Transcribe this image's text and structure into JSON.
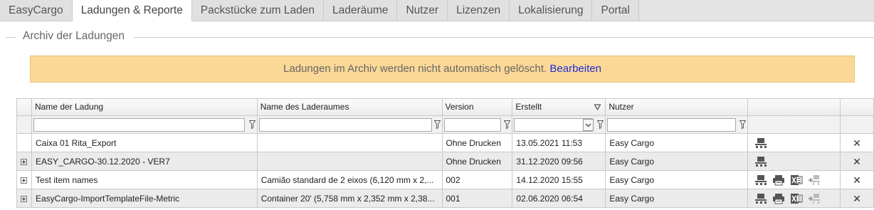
{
  "tabs": [
    {
      "label": "EasyCargo",
      "active": false
    },
    {
      "label": "Ladungen & Reporte",
      "active": true
    },
    {
      "label": "Packstücke zum Laden",
      "active": false
    },
    {
      "label": "Laderäume",
      "active": false
    },
    {
      "label": "Nutzer",
      "active": false
    },
    {
      "label": "Lizenzen",
      "active": false
    },
    {
      "label": "Lokalisierung",
      "active": false
    },
    {
      "label": "Portal",
      "active": false
    }
  ],
  "section": {
    "title": "Archiv der Ladungen"
  },
  "banner": {
    "text": "Ladungen im Archiv werden nicht automatisch gelöscht.",
    "link": "Bearbeiten"
  },
  "grid": {
    "columns": [
      "Name der Ladung",
      "Name des Laderaumes",
      "Version",
      "Erstellt",
      "Nutzer"
    ],
    "sorted_column": "Erstellt",
    "sort_direction": "descending",
    "rows": [
      {
        "expandable": false,
        "name": "Caixa 01 Rita_Export",
        "space": "",
        "version": "Ohne Drucken",
        "created": "13.05.2021 11:53",
        "user": "Easy Cargo",
        "actions": [
          "pallet-icon"
        ]
      },
      {
        "expandable": true,
        "name": "EASY_CARGO-30.12.2020 - VER7",
        "space": "",
        "version": "Ohne Drucken",
        "created": "31.12.2020 09:56",
        "user": "Easy Cargo",
        "actions": [
          "pallet-icon"
        ]
      },
      {
        "expandable": true,
        "name": "Test item names",
        "space": "Camião standard de 2 eixos (6,120 mm x 2,...",
        "version": "002",
        "created": "14.12.2020 15:55",
        "user": "Easy Cargo",
        "actions": [
          "pallet-icon",
          "printer-icon",
          "excel-icon",
          "add-pallet-icon"
        ]
      },
      {
        "expandable": true,
        "name": "EasyCargo-ImportTemplateFile-Metric",
        "space": "Container 20' (5,758 mm x 2,352 mm x 2,38...",
        "version": "001",
        "created": "02.06.2020 06:54",
        "user": "Easy Cargo",
        "actions": [
          "pallet-icon",
          "printer-icon",
          "excel-icon",
          "add-pallet-icon"
        ]
      }
    ]
  }
}
